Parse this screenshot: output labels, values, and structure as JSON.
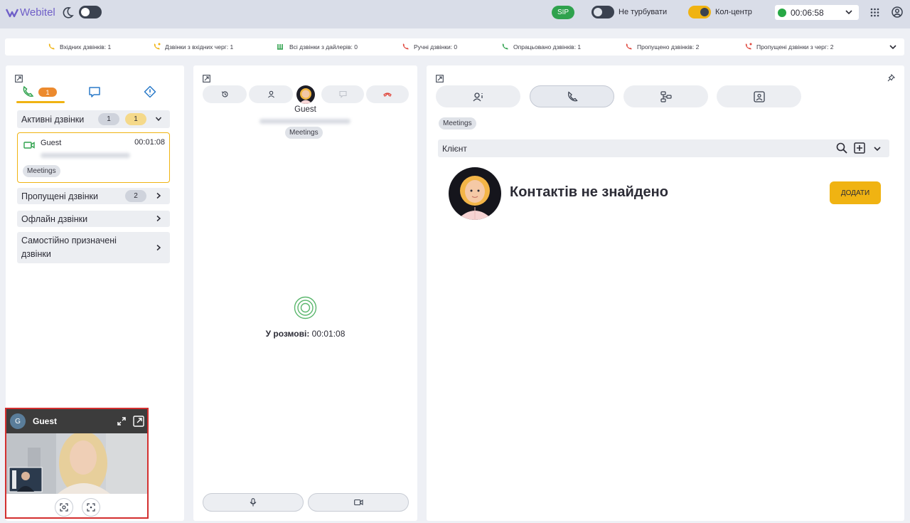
{
  "topbar": {
    "logo_text": "Webitel",
    "sip_label": "SIP",
    "dnd_label": "Не турбувати",
    "callcenter_label": "Кол-центр",
    "status_time": "00:06:58",
    "status_color": "#27a845"
  },
  "stats": {
    "items": [
      {
        "label": "Вхідних дзвінків: 1",
        "icon": "incoming-call-icon",
        "color": "#f0b312"
      },
      {
        "label": "Дзвінки з вхідних черг: 1",
        "icon": "queue-call-icon",
        "color": "#f0b312"
      },
      {
        "label": "Всі дзвінки з дайлерів: 0",
        "icon": "dialer-icon",
        "color": "#2fa24d"
      },
      {
        "label": "Ручні дзвінки: 0",
        "icon": "manual-call-icon",
        "color": "#e0483e"
      },
      {
        "label": "Опрацьовано дзвінків: 1",
        "icon": "handled-call-icon",
        "color": "#2fa24d"
      },
      {
        "label": "Пропущено дзвінків: 2",
        "icon": "missed-call-icon",
        "color": "#e0483e"
      },
      {
        "label": "Пропущені дзвінки з черг: 2",
        "icon": "missed-queue-call-icon",
        "color": "#e0483e"
      }
    ]
  },
  "left": {
    "calls_badge": "1",
    "active": {
      "label": "Активні дзвінки",
      "count_gray": "1",
      "count_yellow": "1"
    },
    "card": {
      "name": "Guest",
      "timer": "00:01:08",
      "tag": "Meetings"
    },
    "missed": {
      "label": "Пропущені дзвінки",
      "count": "2"
    },
    "offline": {
      "label": "Офлайн дзвінки"
    },
    "self_assigned": {
      "line1": "Самостійно призначені",
      "line2": "дзвінки"
    }
  },
  "video": {
    "avatar_letter": "G",
    "name": "Guest"
  },
  "middle": {
    "name": "Guest",
    "tag": "Meetings",
    "talk_label": "У розмові:",
    "talk_time": "00:01:08"
  },
  "right": {
    "tag": "Meetings",
    "client_label": "Клієнт",
    "no_contacts": "Контактів не знайдено",
    "add_label": "ДОДАТИ"
  }
}
